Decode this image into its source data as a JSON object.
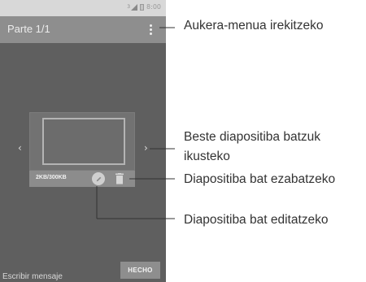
{
  "phone": {
    "status_time": "8:00",
    "sim_label": "3",
    "app_title": "Parte 1/1",
    "nav_prev": "‹",
    "nav_next": "›",
    "slide_size": "2KB/300KB",
    "compose_placeholder": "Escribir mensaje",
    "done_label": "HECHO"
  },
  "icons": {
    "menu": "overflow-menu-icon",
    "edit": "pencil-icon",
    "delete": "trash-icon",
    "signal": "signal-icon",
    "battery": "battery-icon"
  },
  "callouts": {
    "menu": "Aukera-menua irekitzeko",
    "navigate_line1": "Beste diapositiba batzuk",
    "navigate_line2": "ikusteko",
    "delete": "Diapositiba bat ezabatzeko",
    "edit": "Diapositiba bat editatzeko"
  },
  "colors": {
    "screen_bg": "#5f5f5f",
    "app_bar": "#8e8e8e",
    "callout_text": "#333333"
  }
}
